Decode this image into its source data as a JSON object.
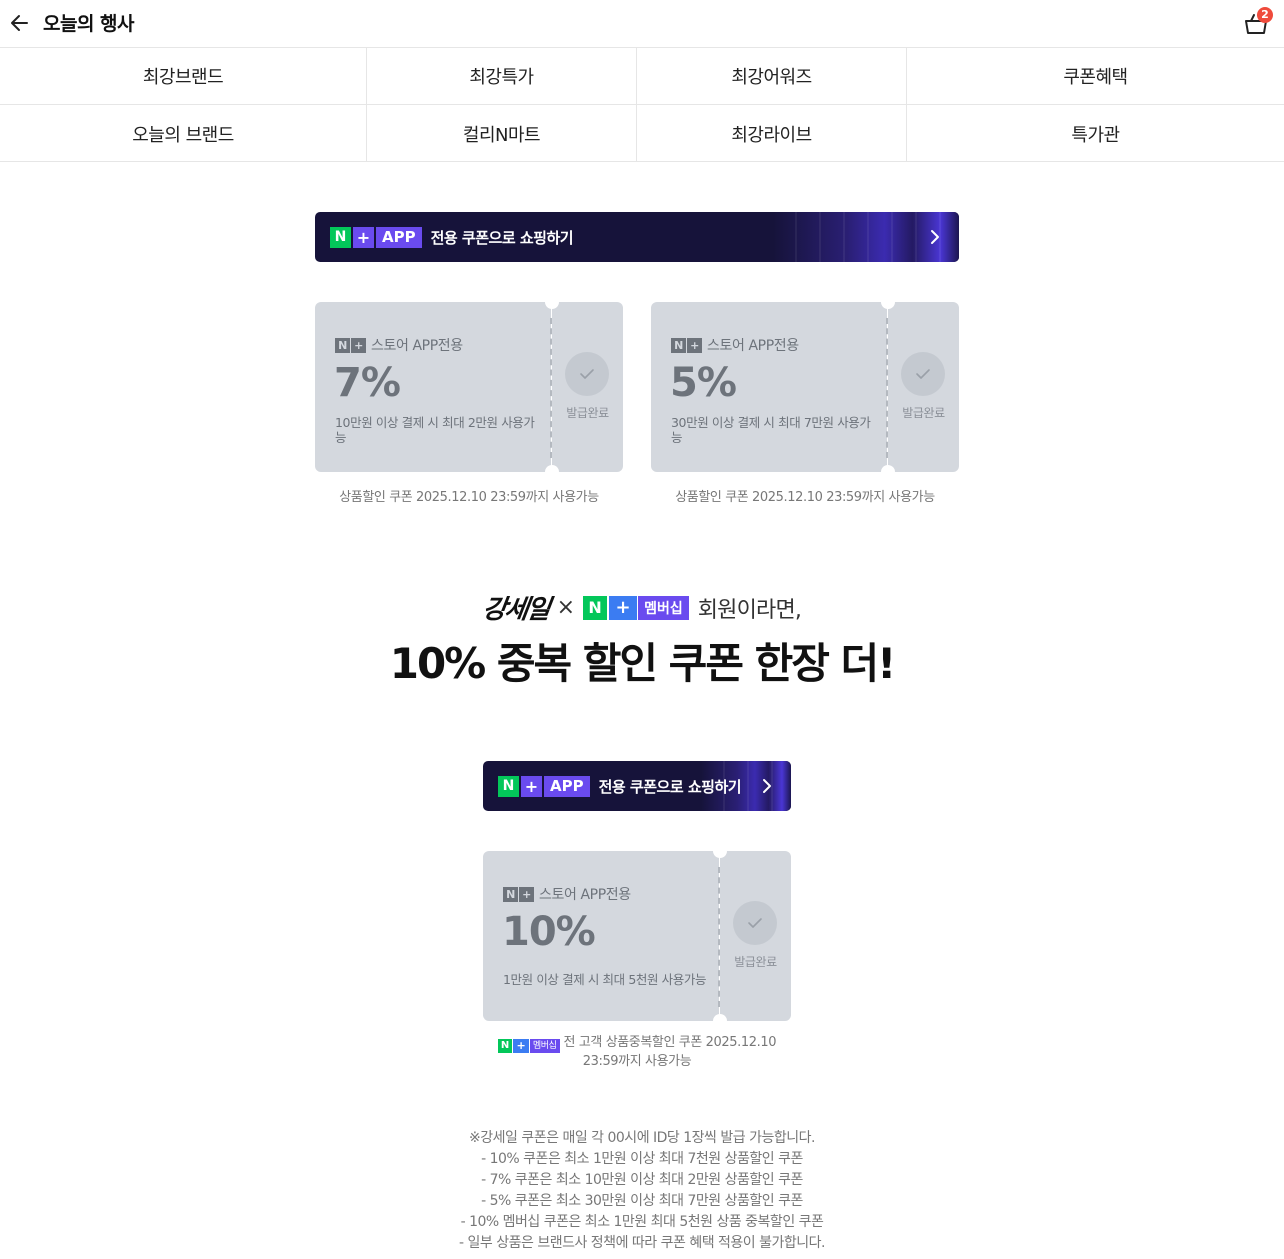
{
  "header": {
    "title": "오늘의 행사",
    "cart_count": "2"
  },
  "nav": {
    "items": [
      {
        "label": "최강브랜드"
      },
      {
        "label": "최강특가"
      },
      {
        "label": "최강어워즈"
      },
      {
        "label": "쿠폰혜택"
      },
      {
        "label": "오늘의 브랜드"
      },
      {
        "label": "컬리N마트"
      },
      {
        "label": "최강라이브"
      },
      {
        "label": "특가관"
      }
    ]
  },
  "banner": {
    "n_label": "N",
    "plus_label": "+",
    "app_label": "APP",
    "text": "전용 쿠폰으로 쇼핑하기"
  },
  "coupons": [
    {
      "store_label": "스토어 APP전용",
      "percent": "7%",
      "desc": "10만원 이상 결제 시 최대 2만원 사용가능",
      "status": "발급완료",
      "footer": "상품할인 쿠폰 2025.12.10 23:59까지 사용가능"
    },
    {
      "store_label": "스토어 APP전용",
      "percent": "5%",
      "desc": "30만원 이상 결제 시 최대 7만원 사용가능",
      "status": "발급완료",
      "footer": "상품할인 쿠폰 2025.12.10 23:59까지 사용가능"
    }
  ],
  "membership": {
    "brand": "강세일",
    "times": "×",
    "n_label": "N",
    "plus_label": "+",
    "badge_text": "멤버십",
    "suffix": "회원이라면,",
    "headline": "10% 중복 할인 쿠폰 한장 더!",
    "coupon": {
      "store_label": "스토어 APP전용",
      "percent": "10%",
      "desc": "1만원 이상 결제 시 최대 5천원 사용가능",
      "status": "발급완료"
    },
    "footer_line1": "전 고객 상품중복할인 쿠폰 2025.12.10",
    "footer_line2": "23:59까지 사용가능"
  },
  "notes": [
    "※강세일 쿠폰은 매일 각 00시에 ID당 1장씩 발급 가능합니다.",
    "- 10% 쿠폰은 최소 1만원 이상 최대 7천원 상품할인 쿠폰",
    "- 7% 쿠폰은 최소 10만원 이상 최대 2만원 상품할인 쿠폰",
    "- 5% 쿠폰은 최소 30만원 이상 최대 7만원 상품할인 쿠폰",
    "- 10% 멤버십 쿠폰은 최소 1만원 최대 5천원 상품 중복할인 쿠폰",
    "- 일부 상품은 브랜드사 정책에 따라 쿠폰 혜택 적용이 불가합니다."
  ],
  "colors": {
    "naver_green": "#03c75a",
    "app_purple": "#6a4bef",
    "banner_bg": "#16133a",
    "coupon_bg": "#d4d8de",
    "badge_red": "#ef4b3c"
  }
}
